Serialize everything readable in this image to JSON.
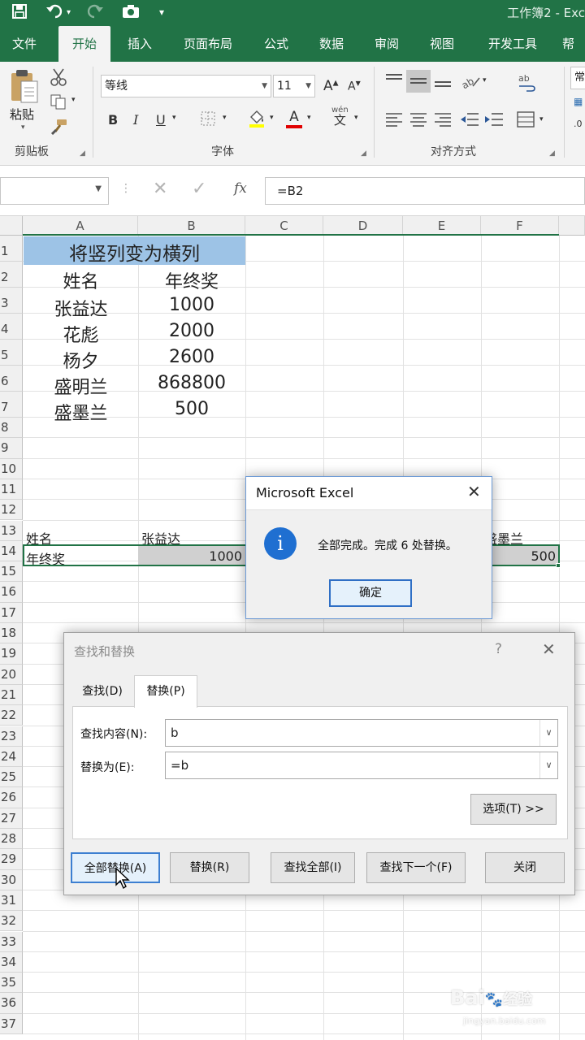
{
  "titlebar": {
    "save_icon": "save-icon",
    "undo_icon": "undo-icon",
    "redo_icon": "redo-icon",
    "camera_icon": "camera-icon",
    "customize_icon": "customize-qat-icon",
    "title": "工作簿2 - Exc"
  },
  "tabs": [
    "文件",
    "开始",
    "插入",
    "页面布局",
    "公式",
    "数据",
    "审阅",
    "视图",
    "开发工具",
    "帮"
  ],
  "ribbon": {
    "clipboard": {
      "paste_label": "粘贴",
      "group_label": "剪贴板"
    },
    "font": {
      "font_name": "等线",
      "font_size": "11",
      "group_label": "字体",
      "bold": "B",
      "italic": "I",
      "underline": "U",
      "grow": "A",
      "shrink": "A",
      "font_color_letter": "A",
      "wen_label": "wén"
    },
    "alignment": {
      "group_label": "对齐方式"
    },
    "number": {
      "format_label": "常"
    }
  },
  "formula_bar": {
    "formula": "=B2",
    "fx_label": "fx"
  },
  "sheet": {
    "columns": [
      "A",
      "B",
      "C",
      "D",
      "E",
      "F"
    ],
    "rows": [
      "1",
      "2",
      "3",
      "4",
      "5",
      "6",
      "7",
      "8",
      "9",
      "10",
      "11",
      "12",
      "13",
      "14",
      "15",
      "16",
      "17",
      "18",
      "19",
      "20",
      "21",
      "22",
      "23",
      "24",
      "25",
      "26",
      "27",
      "28",
      "29",
      "30",
      "31",
      "32",
      "33",
      "34",
      "35",
      "36",
      "37"
    ],
    "title_cell": "将竖列变为横列",
    "header_row": [
      "姓名",
      "年终奖"
    ],
    "data": [
      [
        "张益达",
        "1000"
      ],
      [
        "花彪",
        "2000"
      ],
      [
        "杨夕",
        "2600"
      ],
      [
        "盛明兰",
        "868800"
      ],
      [
        "盛墨兰",
        "500"
      ]
    ],
    "row13": {
      "a": "姓名",
      "b": "张益达",
      "f": "盛墨兰"
    },
    "row14": {
      "a": "年终奖",
      "b": "1000",
      "f": "500"
    }
  },
  "msgbox": {
    "title": "Microsoft Excel",
    "message": "全部完成。完成 6 处替换。",
    "ok": "确定",
    "icon": "info-icon"
  },
  "find_replace": {
    "title": "查找和替换",
    "help": "?",
    "tab_find": "查找(D)",
    "tab_replace": "替换(P)",
    "find_label": "查找内容(N):",
    "find_value": "b",
    "replace_label": "替换为(E):",
    "replace_value": "=b",
    "options": "选项(T) >>",
    "buttons": [
      "全部替换(A)",
      "替换(R)",
      "查找全部(I)",
      "查找下一个(F)",
      "关闭"
    ]
  },
  "watermark": {
    "brand": "Bai",
    "brand2": "经验",
    "url": "jingyan.baidu.com"
  }
}
